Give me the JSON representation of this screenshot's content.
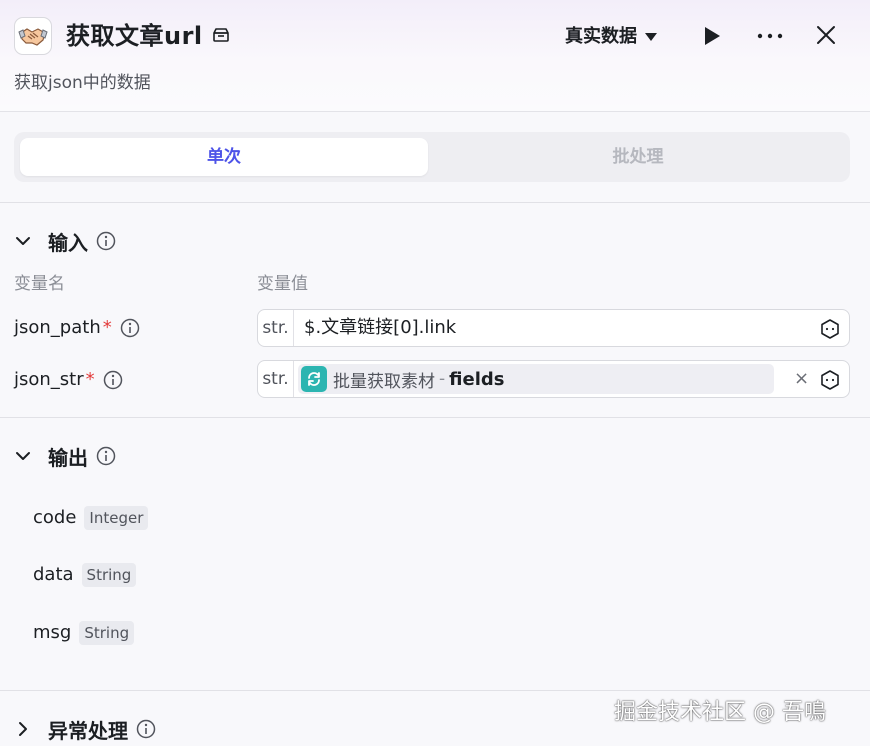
{
  "header": {
    "title": "获取文章url",
    "subtitle": "获取json中的数据",
    "data_mode": "真实数据",
    "icons": {
      "app": "handshake-icon",
      "title_badge": "box-icon",
      "play": "play-icon",
      "more": "more-icon",
      "close": "close-icon"
    }
  },
  "tabs": [
    {
      "label": "单次",
      "active": true
    },
    {
      "label": "批处理",
      "active": false
    }
  ],
  "input_section": {
    "title": "输入",
    "col_name": "变量名",
    "col_value": "变量值",
    "rows": [
      {
        "name": "json_path",
        "required_mark": "*",
        "type": "str.",
        "value": "$.文章链接[0].link"
      },
      {
        "name": "json_str",
        "required_mark": "*",
        "type": "str.",
        "ref_node": "批量获取素材",
        "ref_sep": "-",
        "ref_field": "fields",
        "clear": "×"
      }
    ]
  },
  "output_section": {
    "title": "输出",
    "rows": [
      {
        "name": "code",
        "type": "Integer"
      },
      {
        "name": "data",
        "type": "String"
      },
      {
        "name": "msg",
        "type": "String"
      }
    ]
  },
  "exception_section": {
    "title": "异常处理"
  },
  "watermark": "掘金技术社区 @ 吾鳴",
  "colors": {
    "accent": "#4d53e8",
    "required": "#e33b3b",
    "ref_badge": "#2cb5b1"
  }
}
